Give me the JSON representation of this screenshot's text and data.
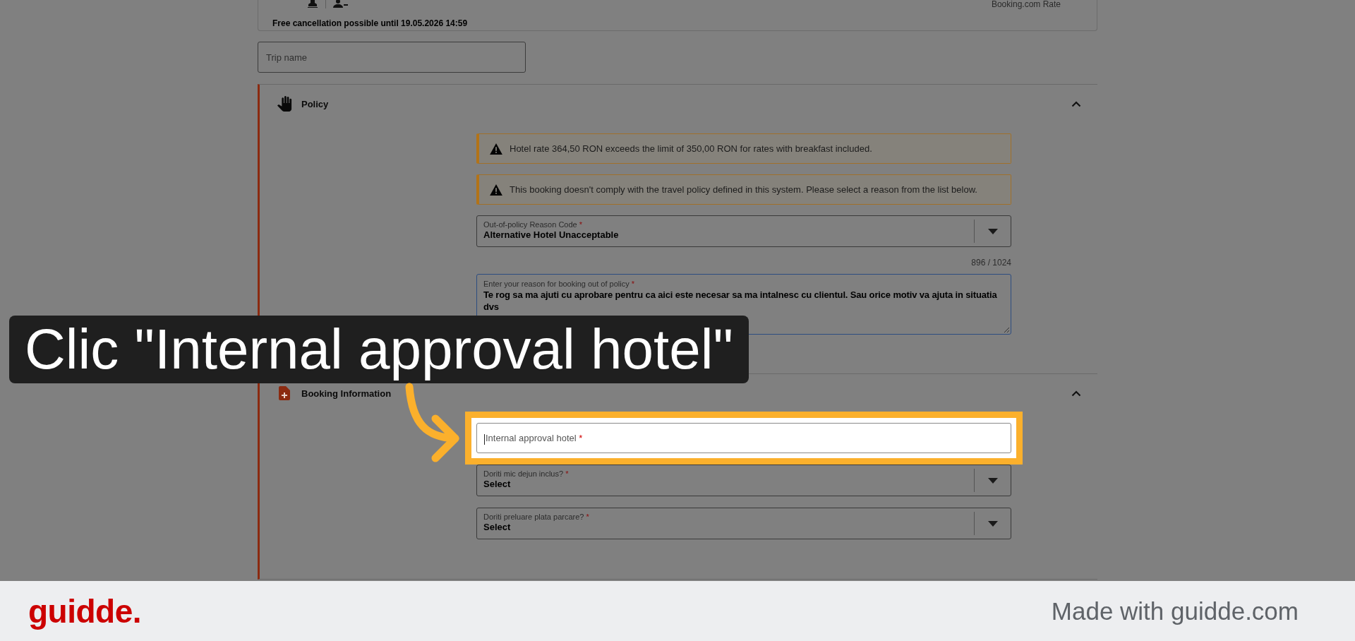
{
  "booking_card": {
    "rate_label": "Booking.com Rate",
    "cancellation_note": "Free cancellation possible until 19.05.2026 14:59"
  },
  "trip_name": {
    "placeholder": "Trip name"
  },
  "sections": [
    {
      "kind": "policy",
      "title": "Policy",
      "expanded": true,
      "alerts": [
        {
          "text": "Hotel rate 364,50 RON exceeds the limit of 350,00 RON for rates with breakfast included."
        },
        {
          "text": "This booking doesn't comply with the travel policy defined in this system. Please select a reason from the list below."
        }
      ],
      "fields": [
        {
          "kind": "select",
          "label": "Out-of-policy Reason Code",
          "required_mark": "*",
          "value": "Alternative Hotel Unacceptable"
        },
        {
          "kind": "textarea",
          "label": "Enter your reason for booking out of policy",
          "required_mark": "*",
          "counter": "896 / 1024",
          "value": "Te rog sa ma ajuti cu aprobare pentru ca aici este necesar sa ma intalnesc cu clientul. Sau orice motiv va ajuta in situatia dvs"
        }
      ]
    },
    {
      "kind": "booking",
      "title": "Booking Information",
      "expanded": true,
      "fields": [
        {
          "kind": "text",
          "placeholder": "Internal approval hotel",
          "required_mark": "*",
          "highlighted": true,
          "focused": true
        },
        {
          "kind": "select",
          "label": "Doriti mic dejun inclus?",
          "required_mark": "*",
          "value": "Select"
        },
        {
          "kind": "select",
          "label": "Doriti preluare plata parcare?",
          "required_mark": "*",
          "value": "Select"
        }
      ]
    }
  ],
  "callout": {
    "text": "Clic \"Internal approval hotel\""
  },
  "footer": {
    "logo": "guidde.",
    "credit": "Made with guidde.com"
  }
}
